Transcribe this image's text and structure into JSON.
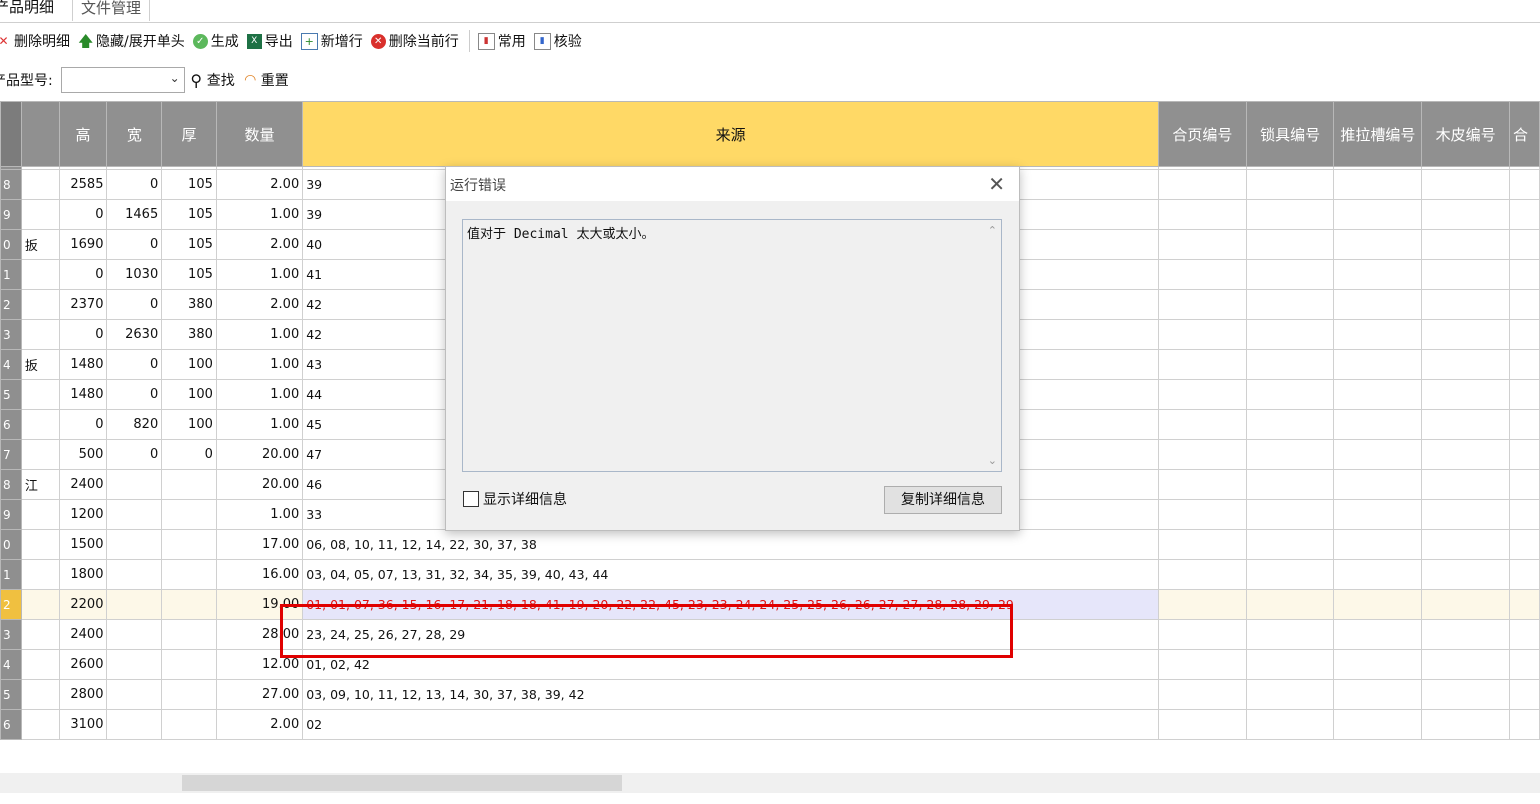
{
  "tabs": [
    "产品明细",
    "文件管理"
  ],
  "toolbar": {
    "delete_detail": "删除明细",
    "toggle_single": "隐藏/展开单头",
    "generate": "生成",
    "export": "导出",
    "new_row": "新增行",
    "delete_row": "删除当前行",
    "common": "常用",
    "verify": "核验"
  },
  "filter": {
    "label": "产品型号:",
    "search": "查找",
    "reset": "重置"
  },
  "grid": {
    "headers": [
      "高",
      "宽",
      "厚",
      "数量",
      "来源",
      "合页编号",
      "锁具编号",
      "推拉槽编号",
      "木皮编号",
      "合"
    ],
    "rows": [
      {
        "rh": "",
        "c1": "",
        "h": "",
        "w": "",
        "t": "",
        "q": "",
        "src": ""
      },
      {
        "rh": "8",
        "c1": "",
        "h": "2585",
        "w": "0",
        "t": "105",
        "q": "2.00",
        "src": "39"
      },
      {
        "rh": "9",
        "c1": "",
        "h": "0",
        "w": "1465",
        "t": "105",
        "q": "1.00",
        "src": "39"
      },
      {
        "rh": "0",
        "c1": "扳",
        "h": "1690",
        "w": "0",
        "t": "105",
        "q": "2.00",
        "src": "40"
      },
      {
        "rh": "1",
        "c1": "",
        "h": "0",
        "w": "1030",
        "t": "105",
        "q": "1.00",
        "src": "41"
      },
      {
        "rh": "2",
        "c1": "",
        "h": "2370",
        "w": "0",
        "t": "380",
        "q": "2.00",
        "src": "42"
      },
      {
        "rh": "3",
        "c1": "",
        "h": "0",
        "w": "2630",
        "t": "380",
        "q": "1.00",
        "src": "42"
      },
      {
        "rh": "4",
        "c1": "扳",
        "h": "1480",
        "w": "0",
        "t": "100",
        "q": "1.00",
        "src": "43"
      },
      {
        "rh": "5",
        "c1": "",
        "h": "1480",
        "w": "0",
        "t": "100",
        "q": "1.00",
        "src": "44"
      },
      {
        "rh": "6",
        "c1": "",
        "h": "0",
        "w": "820",
        "t": "100",
        "q": "1.00",
        "src": "45"
      },
      {
        "rh": "7",
        "c1": "",
        "h": "500",
        "w": "0",
        "t": "0",
        "q": "20.00",
        "src": "47"
      },
      {
        "rh": "8",
        "c1": "江",
        "h": "2400",
        "w": "",
        "t": "",
        "q": "20.00",
        "src": "46"
      },
      {
        "rh": "9",
        "c1": "",
        "h": "1200",
        "w": "",
        "t": "",
        "q": "1.00",
        "src": "33"
      },
      {
        "rh": "0",
        "c1": "",
        "h": "1500",
        "w": "",
        "t": "",
        "q": "17.00",
        "src": "06, 08, 10, 11, 12, 14, 22, 30, 37, 38"
      },
      {
        "rh": "1",
        "c1": "",
        "h": "1800",
        "w": "",
        "t": "",
        "q": "16.00",
        "src": "03, 04, 05, 07, 13, 31, 32, 34, 35, 39, 40, 43, 44"
      },
      {
        "rh": "2",
        "c1": "",
        "h": "2200",
        "w": "",
        "t": "",
        "q": "19.00",
        "src": "01, 01, 07, 36, 15, 16, 17, 21, 18, 18, 41, 19, 20, 22, 22, 45, 23, 23, 24, 24, 25, 25, 26, 26, 27, 27, 28, 28, 29, 29"
      },
      {
        "rh": "3",
        "c1": "",
        "h": "2400",
        "w": "",
        "t": "",
        "q": "28.00",
        "src": "23, 24, 25, 26, 27, 28, 29"
      },
      {
        "rh": "4",
        "c1": "",
        "h": "2600",
        "w": "",
        "t": "",
        "q": "12.00",
        "src": "01, 02, 42"
      },
      {
        "rh": "5",
        "c1": "",
        "h": "2800",
        "w": "",
        "t": "",
        "q": "27.00",
        "src": "03, 09, 10, 11, 12, 13, 14, 30, 37, 38, 39, 42"
      },
      {
        "rh": "6",
        "c1": "",
        "h": "3100",
        "w": "",
        "t": "",
        "q": "2.00",
        "src": "02"
      }
    ]
  },
  "dialog": {
    "title": "运行错误",
    "message": "值对于 Decimal 太大或太小。",
    "show_detail": "显示详细信息",
    "copy_button": "复制详细信息"
  },
  "colors": {
    "header_gray": "#909090",
    "source_header": "#ffd966",
    "highlight_red": "#e00000",
    "selected_text": "#e01010"
  }
}
